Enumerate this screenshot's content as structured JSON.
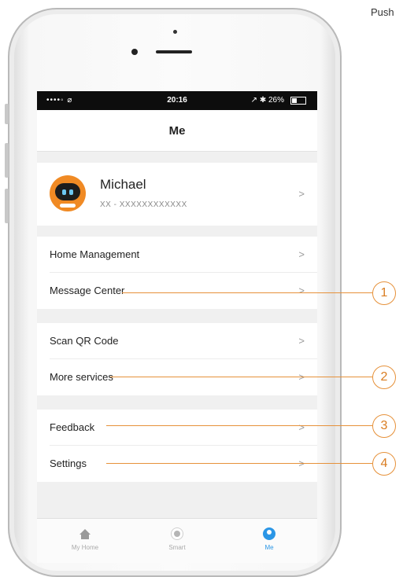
{
  "top_note": "Push",
  "status_bar": {
    "signal": "••••◦ ⌀",
    "time": "20:16",
    "battery": "↗ ✱ 26%"
  },
  "header": {
    "title": "Me"
  },
  "profile": {
    "name": "Michael",
    "account": "XX - XXXXXXXXXXXX"
  },
  "menu": {
    "home_management": "Home Management",
    "message_center": "Message Center",
    "scan_qr": "Scan QR Code",
    "more_services": "More services",
    "feedback": "Feedback",
    "settings": "Settings",
    "chevron": ">"
  },
  "tabs": [
    {
      "label": "My Home",
      "icon": "home-icon"
    },
    {
      "label": "Smart",
      "icon": "sun-icon"
    },
    {
      "label": "Me",
      "icon": "person-icon"
    }
  ],
  "callouts": [
    "1",
    "2",
    "3",
    "4"
  ],
  "colors": {
    "accent": "#2b96e6",
    "callout": "#e6913a",
    "avatar": "#f08a24"
  }
}
